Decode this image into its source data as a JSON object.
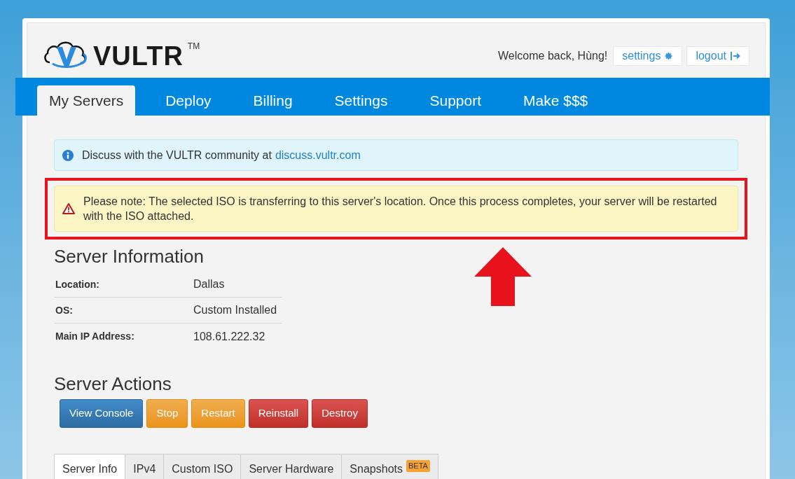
{
  "header": {
    "logo": "VULTR",
    "trademark": "TM",
    "welcome": "Welcome back, Hùng!",
    "links": [
      {
        "label": "settings",
        "kind": "settings"
      },
      {
        "label": "logout",
        "kind": "logout"
      }
    ]
  },
  "nav": [
    {
      "label": "My Servers",
      "selected": true
    },
    {
      "label": "Deploy",
      "selected": false
    },
    {
      "label": "Billing",
      "selected": false
    },
    {
      "label": "Settings",
      "selected": false
    },
    {
      "label": "Support",
      "selected": false
    },
    {
      "label": "Make $$$",
      "selected": false
    }
  ],
  "alerts": [
    {
      "kind": "info",
      "text": "Discuss with the VULTR community at",
      "link": "discuss.vultr.com",
      "highlighted": false
    },
    {
      "kind": "warning",
      "text": "Please note: The selected ISO is transferring to this server's location. Once this process completes, your server will be restarted with the ISO attached.",
      "highlighted": true
    }
  ],
  "server_information": {
    "title": "Server Information",
    "rows": [
      {
        "label": "Location:",
        "value": "Dallas"
      },
      {
        "label": "OS:",
        "value": "Custom Installed"
      },
      {
        "label": "Main IP Address:",
        "value": "108.61.222.32"
      }
    ]
  },
  "server_actions": {
    "title": "Server Actions",
    "buttons": [
      {
        "label": "View Console",
        "kind": "primary"
      },
      {
        "label": "Stop",
        "kind": "warning"
      },
      {
        "label": "Restart",
        "kind": "warning"
      },
      {
        "label": "Reinstall",
        "kind": "danger"
      },
      {
        "label": "Destroy",
        "kind": "danger"
      }
    ]
  },
  "tabs": [
    {
      "label": "Server Info",
      "selected": true
    },
    {
      "label": "IPv4",
      "selected": false
    },
    {
      "label": "Custom ISO",
      "selected": false
    },
    {
      "label": "Server Hardware",
      "selected": false
    },
    {
      "label": "Snapshots",
      "badge": "BETA",
      "selected": false
    }
  ]
}
